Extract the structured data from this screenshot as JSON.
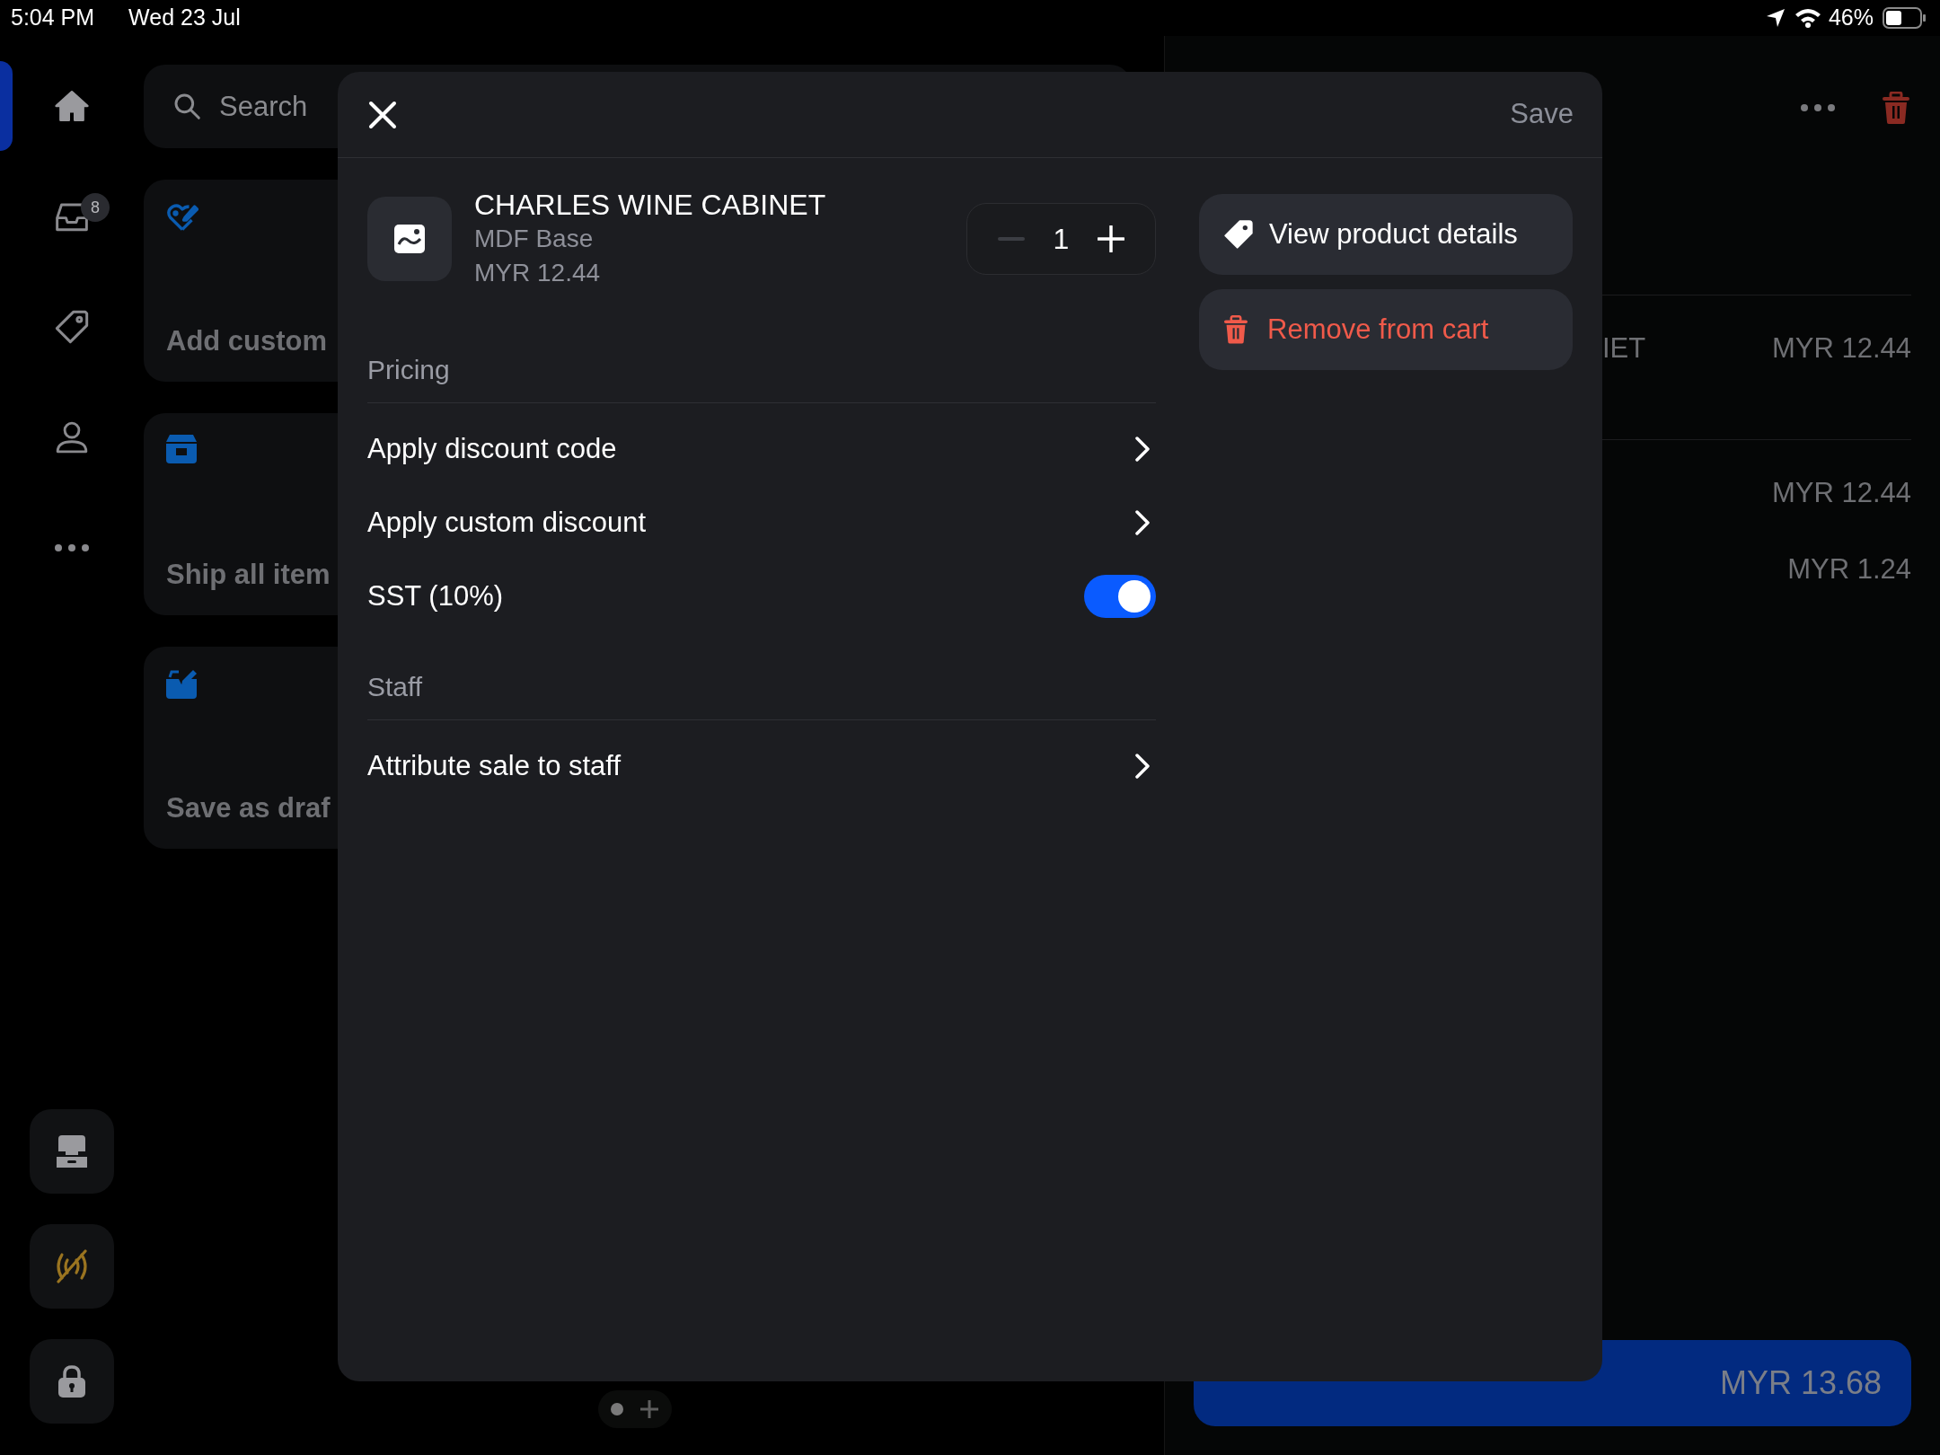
{
  "status_bar": {
    "time": "5:04 PM",
    "date": "Wed 23 Jul",
    "battery": "46%"
  },
  "rail": {
    "items": [
      {
        "kind": "home",
        "selected": true
      },
      {
        "kind": "inbox",
        "selected": false,
        "badge": "8"
      },
      {
        "kind": "tag",
        "selected": false
      },
      {
        "kind": "person",
        "selected": false
      },
      {
        "kind": "more",
        "selected": false
      }
    ],
    "bottom_buttons": [
      {
        "kind": "register"
      },
      {
        "kind": "offline"
      },
      {
        "kind": "lock"
      }
    ]
  },
  "search": {
    "placeholder": "Search"
  },
  "action_tiles": [
    {
      "kind": "tag-edit",
      "label": "Add custom"
    },
    {
      "kind": "box",
      "label": "Ship all item"
    },
    {
      "kind": "draft",
      "label": "Save as draf"
    }
  ],
  "pager": {
    "pages": [
      {
        "selected": true
      }
    ]
  },
  "cart": {
    "lines": [
      {
        "name": "IET",
        "price": "MYR 12.44"
      }
    ],
    "summary": [
      {
        "amount": "MYR 12.44"
      },
      {
        "amount": "MYR 1.24"
      }
    ],
    "checkout": {
      "total": "MYR 13.68"
    }
  },
  "modal": {
    "save": "Save",
    "product": {
      "name": "CHARLES WINE CABINET",
      "variant": "MDF Base",
      "price": "MYR 12.44"
    },
    "quantity": "1",
    "sections": [
      {
        "heading": "Pricing",
        "rows": [
          {
            "kind": "link",
            "label": "Apply discount code"
          },
          {
            "kind": "link",
            "label": "Apply custom discount"
          },
          {
            "kind": "toggle",
            "label": "SST (10%)",
            "on": true
          }
        ]
      },
      {
        "heading": "Staff",
        "rows": [
          {
            "kind": "link",
            "label": "Attribute sale to staff"
          }
        ]
      }
    ],
    "actions": [
      {
        "kind": "details",
        "label": "View product details"
      },
      {
        "kind": "remove",
        "label": "Remove from cart"
      }
    ]
  }
}
